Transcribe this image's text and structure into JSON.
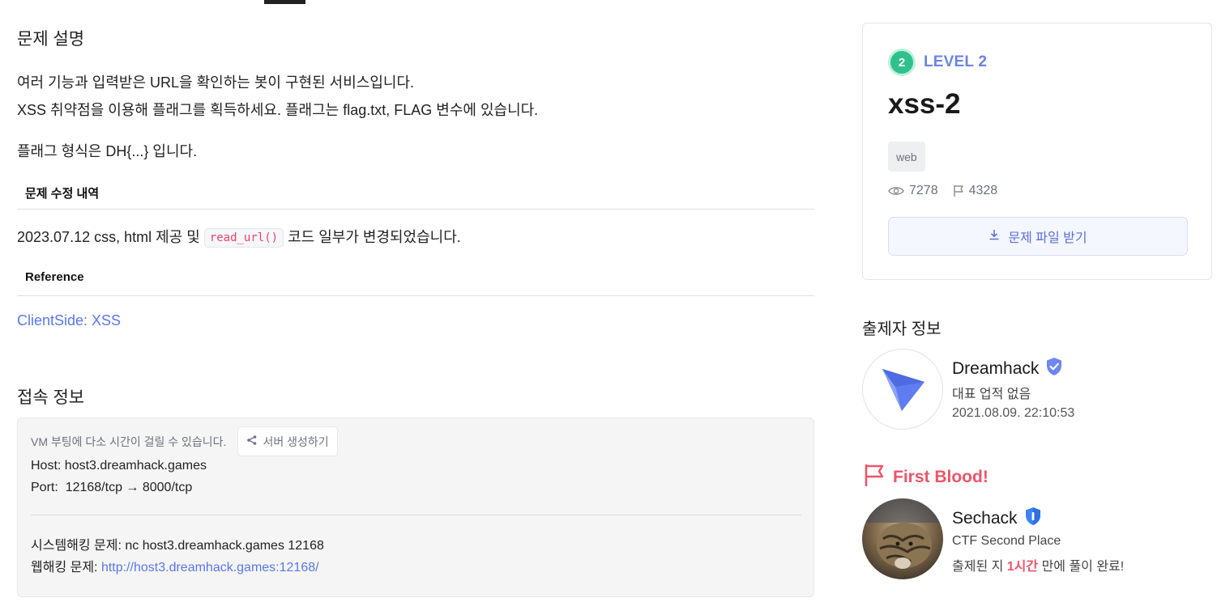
{
  "description": {
    "heading": "문제 설명",
    "line1": "여러 기능과 입력받은 URL을 확인하는 봇이 구현된 서비스입니다.",
    "line2": "XSS 취약점을 이용해 플래그를 획득하세요. 플래그는 flag.txt, FLAG 변수에 있습니다.",
    "line3": "플래그 형식은 DH{...} 입니다.",
    "changelog_heading": "문제 수정 내역",
    "changelog_pre": "2023.07.12 css, html 제공 및 ",
    "changelog_code": "read_url()",
    "changelog_post": " 코드 일부가 변경되었습니다.",
    "reference_heading": "Reference",
    "reference_link": "ClientSide: XSS"
  },
  "connection": {
    "heading": "접속 정보",
    "vm_notice": "VM 부팅에 다소 시간이 걸릴 수 있습니다.",
    "server_button": "서버 생성하기",
    "host_label": "Host:",
    "host_value": "host3.dreamhack.games",
    "port_label": "Port:",
    "port_value": "12168/tcp → 8000/tcp",
    "pwn_label": "시스템해킹 문제:",
    "pwn_value": "nc host3.dreamhack.games 12168",
    "web_label": "웹해킹 문제:",
    "web_value": "http://host3.dreamhack.games:12168/"
  },
  "challenge": {
    "level_number": "2",
    "level_label": "LEVEL 2",
    "title": "xss-2",
    "tag": "web",
    "views": "7278",
    "solves": "4328",
    "download_button": "문제 파일 받기",
    "level_color": "#2fc18c",
    "accent_color": "#6b83e8"
  },
  "author": {
    "heading": "출제자 정보",
    "name": "Dreamhack",
    "subtitle": "대표 업적 없음",
    "date": "2021.08.09. 22:10:53",
    "badge_icon": "verified-badge-icon"
  },
  "first_blood": {
    "heading": "First Blood!",
    "name": "Sechack",
    "subtitle": "CTF Second Place",
    "solved_pre": "출제된 지 ",
    "solved_time": "1시간",
    "solved_post": " 만에 풀이 완료!",
    "accent_color": "#ee5468"
  }
}
